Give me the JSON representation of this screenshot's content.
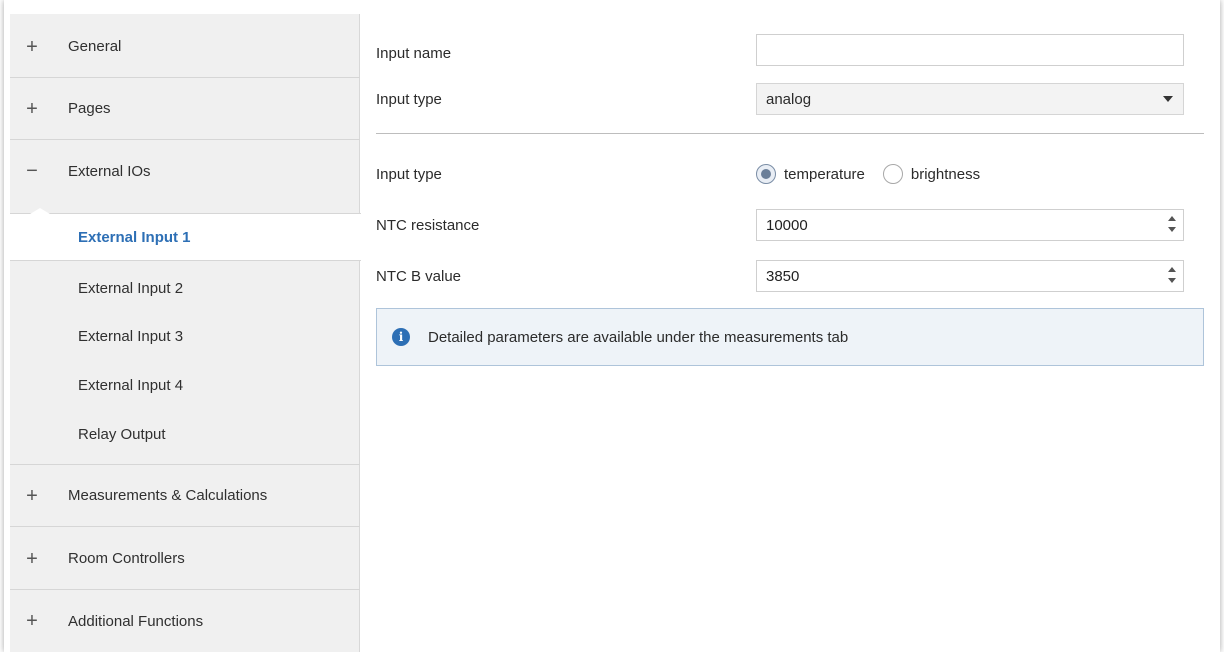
{
  "sidebar": {
    "groups": [
      {
        "sign": "+",
        "label": "General"
      },
      {
        "sign": "+",
        "label": "Pages"
      },
      {
        "sign": "−",
        "label": "External IOs"
      },
      {
        "sign": "+",
        "label": "Measurements & Calculations"
      },
      {
        "sign": "+",
        "label": "Room Controllers"
      },
      {
        "sign": "+",
        "label": "Additional Functions"
      }
    ],
    "subitems": [
      {
        "label": "External Input 1",
        "active": true
      },
      {
        "label": "External Input 2"
      },
      {
        "label": "External Input 3"
      },
      {
        "label": "External Input 4"
      },
      {
        "label": "Relay Output"
      }
    ]
  },
  "main": {
    "input_name": {
      "label": "Input name",
      "value": ""
    },
    "input_type_select": {
      "label": "Input type",
      "value": "analog"
    },
    "input_type_radio": {
      "label": "Input type",
      "options": [
        {
          "label": "temperature",
          "checked": true
        },
        {
          "label": "brightness",
          "checked": false
        }
      ]
    },
    "ntc_resistance": {
      "label": "NTC resistance",
      "value": "10000"
    },
    "ntc_b_value": {
      "label": "NTC B value",
      "value": "3850"
    },
    "info": {
      "icon": "info-icon",
      "glyph": "i",
      "text": "Detailed parameters are available under the measurements tab"
    }
  },
  "colors": {
    "accent": "#2d6fb5",
    "sidebar_bg": "#f0f0f0",
    "info_bg": "#eef3f8",
    "info_border": "#aec4da"
  }
}
